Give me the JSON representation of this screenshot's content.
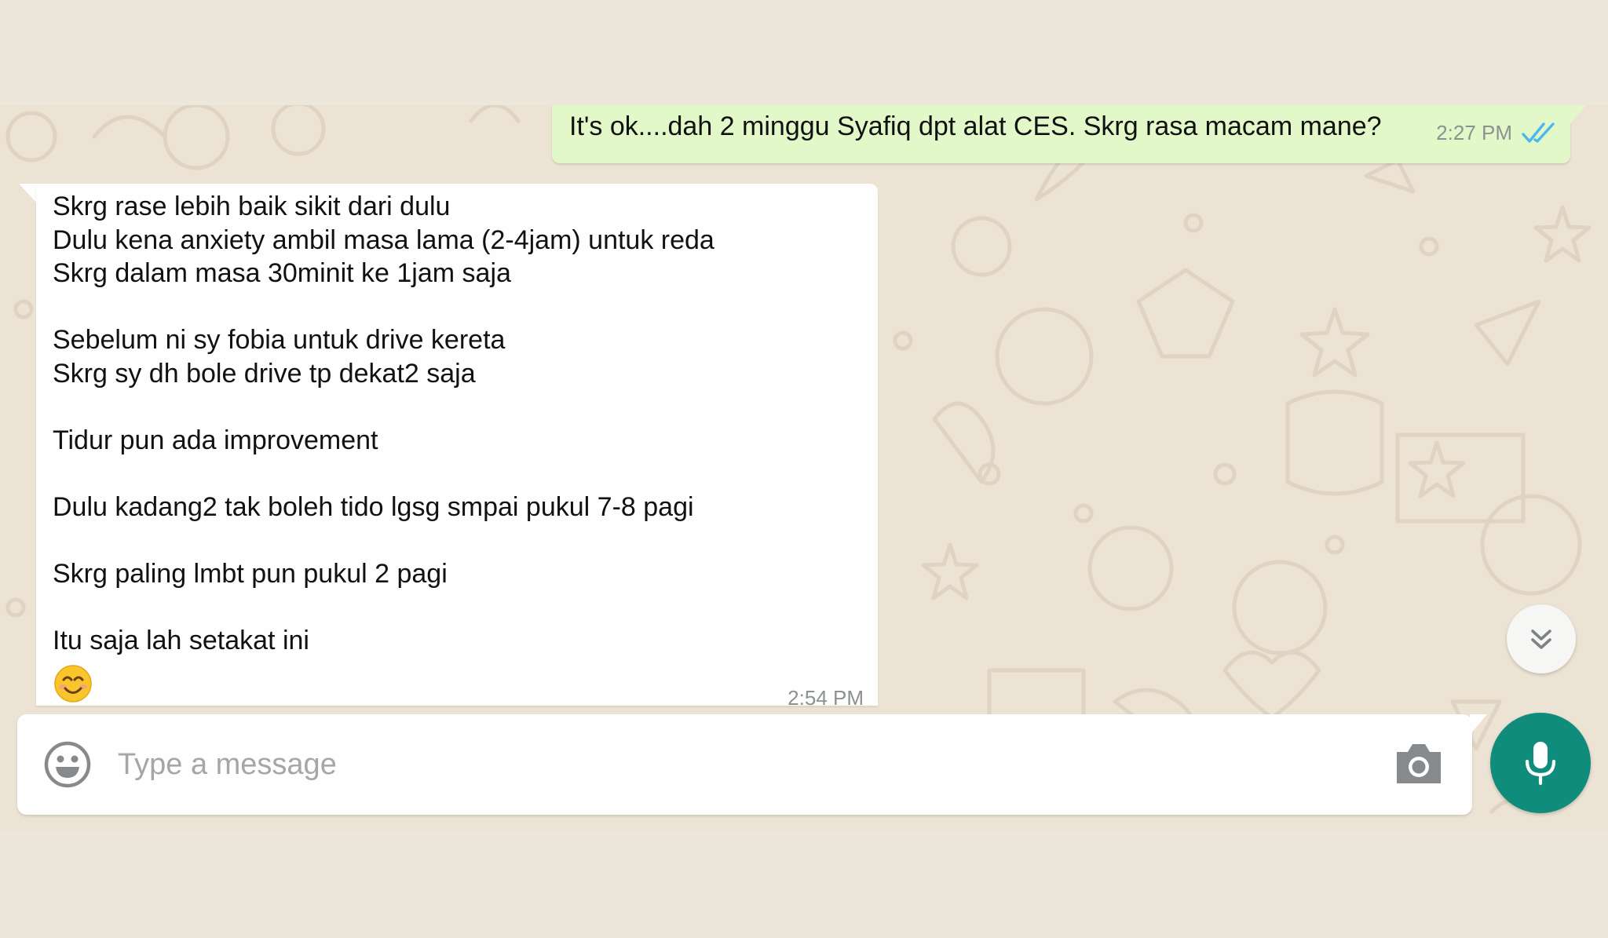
{
  "conversation": {
    "outgoing": {
      "text": "It's ok....dah 2 minggu Syafiq dpt alat CES. Skrg rasa macam mane?",
      "time": "2:27 PM",
      "status_icon": "double-check-icon",
      "tick_color": "#4fb6ec"
    },
    "incoming": {
      "lines": [
        "Skrg rase lebih baik sikit dari dulu",
        "Dulu kena anxiety ambil masa lama (2-4jam) untuk reda",
        "Skrg dalam masa 30minit ke 1jam saja",
        "",
        "Sebelum ni sy fobia untuk drive kereta",
        "Skrg sy dh bole drive tp dekat2 saja",
        "",
        "Tidur pun ada improvement",
        "",
        "Dulu kadang2 tak boleh tido lgsg smpai pukul 7-8 pagi",
        "",
        "Skrg paling lmbt pun pukul 2 pagi",
        "",
        "Itu saja lah setakat ini"
      ],
      "emoji": "smiling-face-emoji",
      "time": "2:54 PM"
    }
  },
  "composer": {
    "placeholder": "Type a message",
    "value": "",
    "emoji_icon": "emoji-icon",
    "camera_icon": "camera-icon",
    "mic_icon": "microphone-icon"
  },
  "scroll_button_icon": "chevron-double-down-icon",
  "colors": {
    "page_background": "#ede6da",
    "outgoing_bubble": "#e2f8c9",
    "incoming_bubble": "#fefefe",
    "send_button": "#0f8c7b",
    "read_ticks": "#4fb6ec"
  }
}
